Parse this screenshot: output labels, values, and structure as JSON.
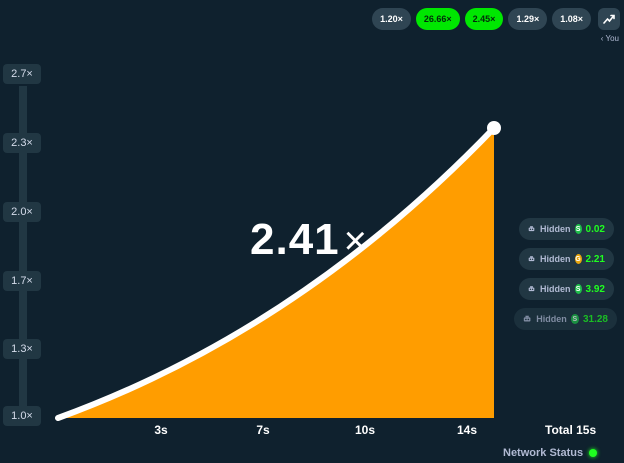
{
  "history": [
    {
      "label": "1.20×",
      "win": false
    },
    {
      "label": "26.66×",
      "win": true
    },
    {
      "label": "2.45×",
      "win": true
    },
    {
      "label": "1.29×",
      "win": false
    },
    {
      "label": "1.08×",
      "win": false
    }
  ],
  "you_link": "‹ You",
  "y_axis": [
    "2.7×",
    "2.3×",
    "2.0×",
    "1.7×",
    "1.3×",
    "1.0×"
  ],
  "x_axis": [
    "3s",
    "7s",
    "10s",
    "14s"
  ],
  "total_label": "Total 15s",
  "current_multiplier": "2.41",
  "multiplier_symbol": "×",
  "players": [
    {
      "name": "Hidden",
      "coin": "S",
      "amount": "0.02",
      "coin_color": "#1fbf4a"
    },
    {
      "name": "Hidden",
      "coin": "G",
      "amount": "2.21",
      "coin_color": "#e8a50b"
    },
    {
      "name": "Hidden",
      "coin": "S",
      "amount": "3.92",
      "coin_color": "#1fbf4a"
    },
    {
      "name": "Hidden",
      "coin": "S",
      "amount": "31.28",
      "coin_color": "#1fbf4a"
    }
  ],
  "network_status": "Network Status",
  "colors": {
    "background": "#0f212e",
    "curve_fill": "#ff9d00",
    "win": "#00e701",
    "panel": "#213743"
  }
}
